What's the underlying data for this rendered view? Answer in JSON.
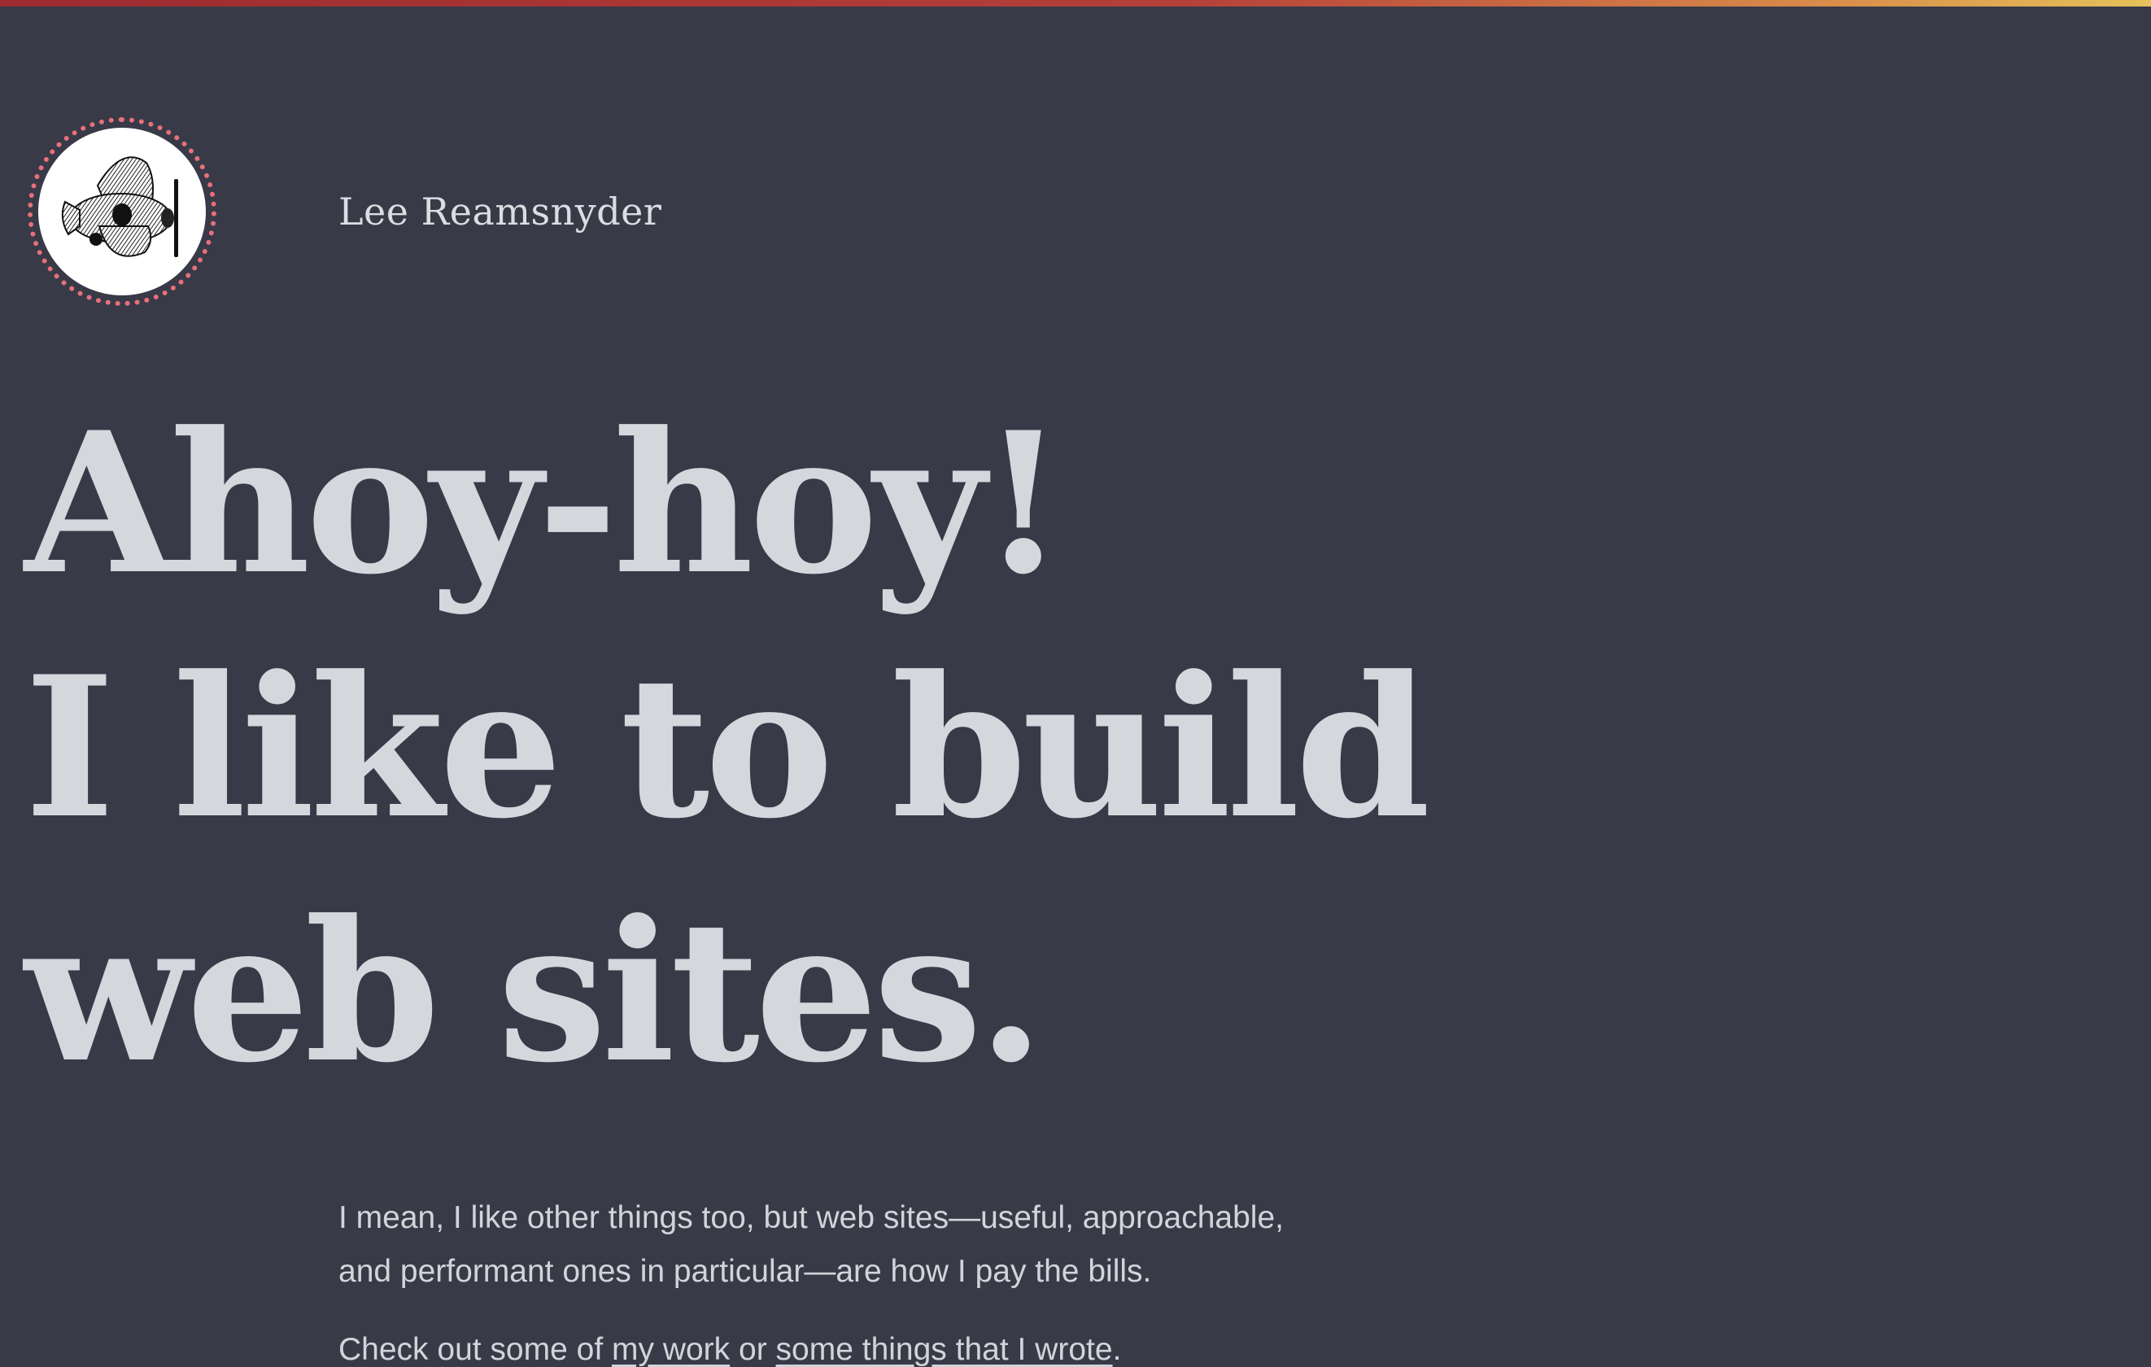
{
  "site": {
    "name": "Lee Reamsnyder",
    "logo_icon": "airplane-icon"
  },
  "hero": {
    "line1": "Ahoy-hoy!",
    "line2": "I like to build",
    "line3": "web sites."
  },
  "intro": {
    "paragraph1_line1": "I mean, I like other things too, but web sites—useful, approachable,",
    "paragraph1_line2": "and performant ones in particular—are how I pay the bills.",
    "paragraph2_prefix": "Check out some of ",
    "paragraph2_work_link": "my work",
    "paragraph2_middle": " or ",
    "paragraph2_writing_link": "some things that I wrote",
    "paragraph2_suffix": "."
  },
  "colors": {
    "background": "#383a48",
    "text": "#d8d9de",
    "accent_ring": "#e8707a",
    "top_bar_start": "#9c2a2f",
    "top_bar_end": "#e5c35a"
  }
}
